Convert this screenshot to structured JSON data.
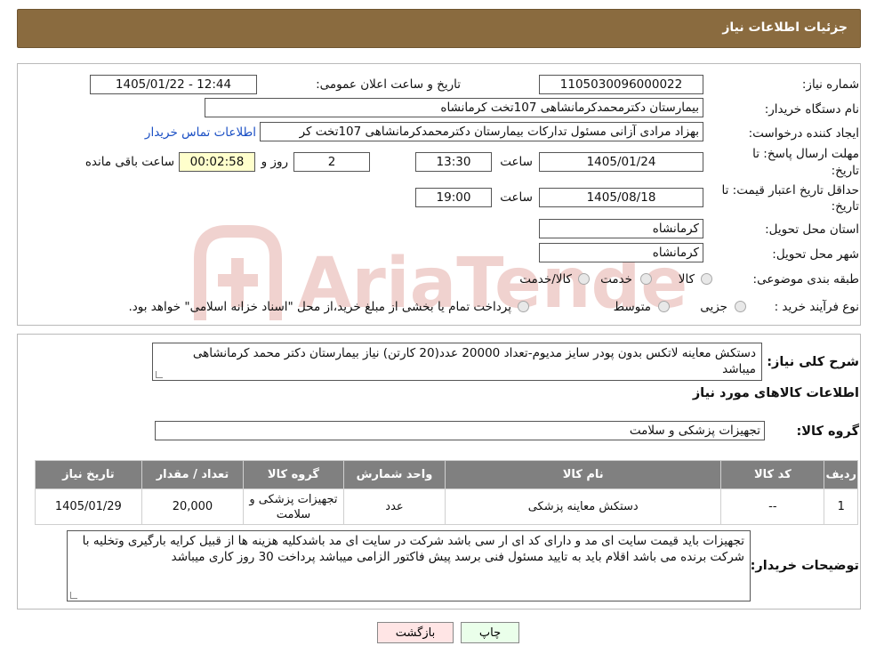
{
  "header": {
    "title": "جزئیات اطلاعات نیاز"
  },
  "watermark": {
    "text": "AriaTender.neT",
    "color": "#c0392b"
  },
  "form": {
    "need_number_label": "شماره نیاز:",
    "need_number": "1105030096000022",
    "announce_label": "تاریخ و ساعت اعلان عمومی:",
    "announce_value": "1405/01/22 - 12:44",
    "buyer_label": "نام دستگاه خریدار:",
    "buyer_value": "بیمارستان دکترمحمدکرمانشاهی 107تخت کرمانشاه",
    "creator_label": "ایجاد کننده درخواست:",
    "creator_value": "بهزاد مرادی آزانی مسئول تدارکات بیمارستان دکترمحمدکرمانشاهی 107تخت کر",
    "contact_link": "اطلاعات تماس خریدار",
    "deadline_label_1": "مهلت ارسال پاسخ: تا",
    "deadline_label_2": "تاریخ:",
    "deadline_date": "1405/01/24",
    "time_label": "ساعت",
    "deadline_time": "13:30",
    "days_value": "2",
    "days_label": "روز و",
    "remaining_value": "00:02:58",
    "remaining_label": "ساعت باقی مانده",
    "validity_label_1": "حداقل تاریخ اعتبار قیمت: تا",
    "validity_label_2": "تاریخ:",
    "validity_date": "1405/08/18",
    "validity_time": "19:00",
    "province_label": "استان محل تحویل:",
    "province_value": "کرمانشاه",
    "city_label": "شهر محل تحویل:",
    "city_value": "کرمانشاه",
    "category_label": "طبقه بندی موضوعی:",
    "category_options": [
      "کالا",
      "خدمت",
      "کالا/خدمت"
    ],
    "process_label": "نوع فرآیند خرید :",
    "process_options": [
      "جزیی",
      "متوسط"
    ],
    "process_note": "پرداخت تمام یا بخشی از مبلغ خرید،از محل \"اسناد خزانه اسلامی\" خواهد بود."
  },
  "summary": {
    "label": "شرح کلی نیاز:",
    "text": "دستکش معاینه لاتکس بدون پودر سایز مدیوم-تعداد 20000 عدد(20 کارتن) نیاز بیمارستان دکتر محمد کرمانشاهی میباشد"
  },
  "goods_section_title": "اطلاعات کالاهای مورد نیاز",
  "goods_group": {
    "label": "گروه کالا:",
    "value": "تجهیزات پزشکی و سلامت"
  },
  "table": {
    "headers": [
      "ردیف",
      "کد کالا",
      "نام کالا",
      "واحد شمارش",
      "گروه کالا",
      "تعداد / مقدار",
      "تاریخ نیاز"
    ],
    "rows": [
      [
        "1",
        "--",
        "دستکش معاینه پزشکی",
        "عدد",
        "تجهیزات پزشکی و سلامت",
        "20,000",
        "1405/01/29"
      ]
    ]
  },
  "notes": {
    "label": "توضیحات خریدار:",
    "text": "تجهیزات باید قیمت سایت ای مد و دارای کد ای ار سی باشد شرکت در سایت ای مد باشدکلیه هزینه ها از قبیل کرایه بارگیری وتخلیه با شرکت برنده می باشد اقلام باید به تایید مسئول فنی برسد پیش فاکتور الزامی میباشد پرداخت 30 روز کاری میباشد"
  },
  "buttons": {
    "print": "چاپ",
    "back": "بازگشت"
  }
}
